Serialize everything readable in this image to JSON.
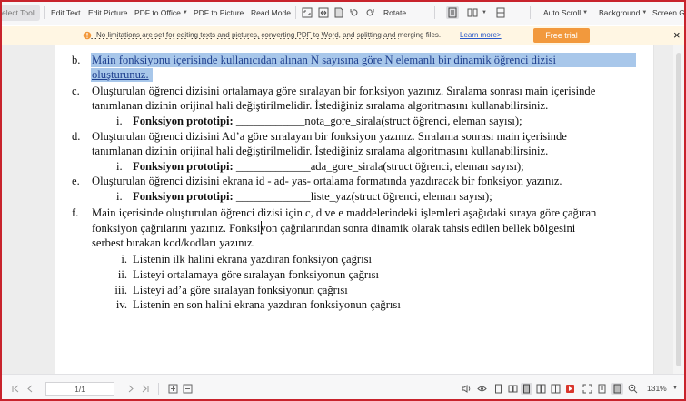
{
  "toolbar": {
    "select_tool": "elect Tool",
    "edit_text": "Edit Text",
    "edit_picture": "Edit Picture",
    "pdf_to_office": "PDF to Office",
    "pdf_to_picture": "PDF to Picture",
    "read_mode": "Read Mode",
    "rotate": "Rotate",
    "auto_scroll": "Auto Scroll",
    "background": "Background",
    "screen_grab": "Screen Gr"
  },
  "notice": {
    "text": "No limitations are set for editing texts and pictures, converting PDF to Word, and splitting and merging files.",
    "link": "Learn more>",
    "button": "Free trial",
    "close": "×",
    "accent": "#f2993d"
  },
  "document": {
    "b_label": "b.",
    "b_line1": "Main fonksiyonu içerisinde kullanıcıdan alınan N sayısına göre N elemanlı bir dinamik öğrenci dizisi",
    "b_line2": "oluşturunuz.",
    "c_label": "c.",
    "c_line1": "Oluşturulan öğrenci dizisini ortalamaya göre sıralayan bir fonksiyon yazınız. Sıralama sonrası main içerisinde",
    "c_line2": "tanımlanan dizinin orijinal hali değiştirilmelidir. İstediğiniz sıralama algoritmasını kullanabilirsiniz.",
    "c_sub_label": "i.",
    "c_sub_bold": "Fonksiyon prototipi:",
    "c_sub_rest": " ____________nota_gore_sirala(struct öğrenci, eleman sayısı);",
    "d_label": "d.",
    "d_line1": "Oluşturulan öğrenci dizisini Ad’a göre sıralayan bir fonksiyon yazınız. Sıralama sonrası main içerisinde",
    "d_line2": "tanımlanan dizinin orijinal hali değiştirilmelidir. İstediğiniz sıralama algoritmasını kullanabilirsiniz.",
    "d_sub_label": "i.",
    "d_sub_bold": "Fonksiyon prototipi:",
    "d_sub_rest": " _____________ada_gore_sirala(struct öğrenci, eleman sayısı);",
    "e_label": "e.",
    "e_line1": "Oluşturulan öğrenci dizisini ekrana id - ad- yas- ortalama formatında yazdıracak bir fonksiyon yazınız.",
    "e_sub_label": "i.",
    "e_sub_bold": "Fonksiyon prototipi:",
    "e_sub_rest": " _____________liste_yaz(struct öğrenci, eleman sayısı);",
    "f_label": "f.",
    "f_line1": "Main içerisinde oluşturulan öğrenci dizisi için c, d ve e maddelerindeki işlemleri aşağıdaki sıraya göre çağıran",
    "f_line2": "fonksiyon çağrılarını yazınız. Fonksiyon çağrılarından sonra dinamik olarak tahsis edilen bellek bölgesini",
    "f_line3": "serbest bırakan kod/kodları yazınız.",
    "f_items": [
      {
        "label": "i.",
        "text": "Listenin ilk halini ekrana yazdıran fonksiyon çağrısı"
      },
      {
        "label": "ii.",
        "text": "Listeyi ortalamaya göre sıralayan fonksiyonun çağrısı"
      },
      {
        "label": "iii.",
        "text": "Listeyi ad’a göre sıralayan fonksiyonun çağrısı"
      },
      {
        "label": "iv.",
        "text": "Listenin en son halini ekrana yazdıran fonksiyonun çağrısı"
      }
    ],
    "highlight_color": "#a8c7ea"
  },
  "statusbar": {
    "page": "1/1",
    "zoom": "131%"
  },
  "colors": {
    "frame": "#c8232c",
    "toolbar_bg": "#f7f7f8",
    "notice_bg": "#fff6e3"
  }
}
